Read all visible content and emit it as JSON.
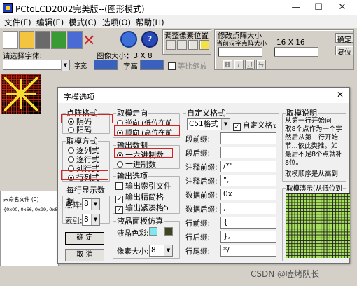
{
  "window": {
    "title": "PCtoLCD2002完美版--(图形模式)",
    "min": "—",
    "max": "☐",
    "close": "✕"
  },
  "menu": [
    "文件(F)",
    "编辑(E)",
    "模式(C)",
    "选项(O)",
    "帮助(H)"
  ],
  "toolbar": {
    "pixel_group": "调整像素位置",
    "edit_group": "修改点阵大小",
    "font_label": "当前汉字点阵大小",
    "size_label": "16 X 16",
    "size_w": "16",
    "size_h": "16",
    "confirm": "确定",
    "restore": "复位",
    "choose_font": "请选择字体:",
    "image_size": "图像大小：3 X 8",
    "char_width": "字宽",
    "char_height": "字高",
    "proportional": "等比缩放",
    "bold": "B",
    "italic": "I",
    "underline": "U",
    "strike": "S"
  },
  "left_panel": {
    "file_label": "未命名文件 (0)",
    "data": "{0x00, 0x66, 0x99, 0x81, 0x"
  },
  "dialog": {
    "title": "字模选项",
    "lattice": {
      "legend": "点阵格式",
      "options": [
        "阴码",
        "阳码"
      ],
      "selected": 0
    },
    "mode": {
      "legend": "取模方式",
      "options": [
        "逐列式",
        "逐行式",
        "列行式",
        "行列式"
      ],
      "selected": 3
    },
    "direction": {
      "legend": "取模走向",
      "options": [
        "逆向 (低位在前",
        "顺向 (高位在前"
      ],
      "selected": 1
    },
    "base": {
      "legend": "输出数制",
      "options": [
        "十六进制数",
        "十进制数"
      ],
      "selected": 0
    },
    "output": {
      "legend": "输出选项",
      "items": [
        "输出索引文件",
        "输出精简格",
        "输出紧凑格5"
      ],
      "checked": [
        false,
        true,
        true
      ]
    },
    "per_line": {
      "legend": "每行显示数据",
      "dot_label": "点阵:",
      "dot_value": "8",
      "index_label": "索引:",
      "index_value": "8"
    },
    "ok": "确 定",
    "cancel": "取 消",
    "lcd": {
      "legend": "液晶面板仿真",
      "color_label": "液晶色彩:",
      "pixel_label": "像素大小:",
      "pixel_value": "8",
      "color_on": "#7de8f0",
      "color_off": "#404420"
    },
    "custom": {
      "legend": "自定义格式",
      "format": "C51格式",
      "custom_check": "自定义格式",
      "rows": [
        {
          "label": "段前缀:",
          "value": ""
        },
        {
          "label": "段后缀:",
          "value": ""
        },
        {
          "label": "注释前缀:",
          "value": "/*\""
        },
        {
          "label": "注释后缀:",
          "value": "\","
        },
        {
          "label": "数据前缀:",
          "value": "0x"
        },
        {
          "label": "数据后缀:",
          "value": ","
        },
        {
          "label": "行前缀:",
          "value": "{"
        },
        {
          "label": "行后缀:",
          "value": "},"
        },
        {
          "label": "行尾缀:",
          "value": "*/"
        }
      ]
    },
    "desc": {
      "legend": "取模说明",
      "lines": [
        "从第一行开始向",
        "取8个点作为一个字",
        "然后从第二行开始",
        "节...依此类推。如",
        "最后不足8个点就补",
        "8位。"
      ],
      "footer": "取模顺序是从高到"
    },
    "demo_legend": "取模演示(从低位到"
  },
  "watermark": "CSDN @嗑烤队长"
}
